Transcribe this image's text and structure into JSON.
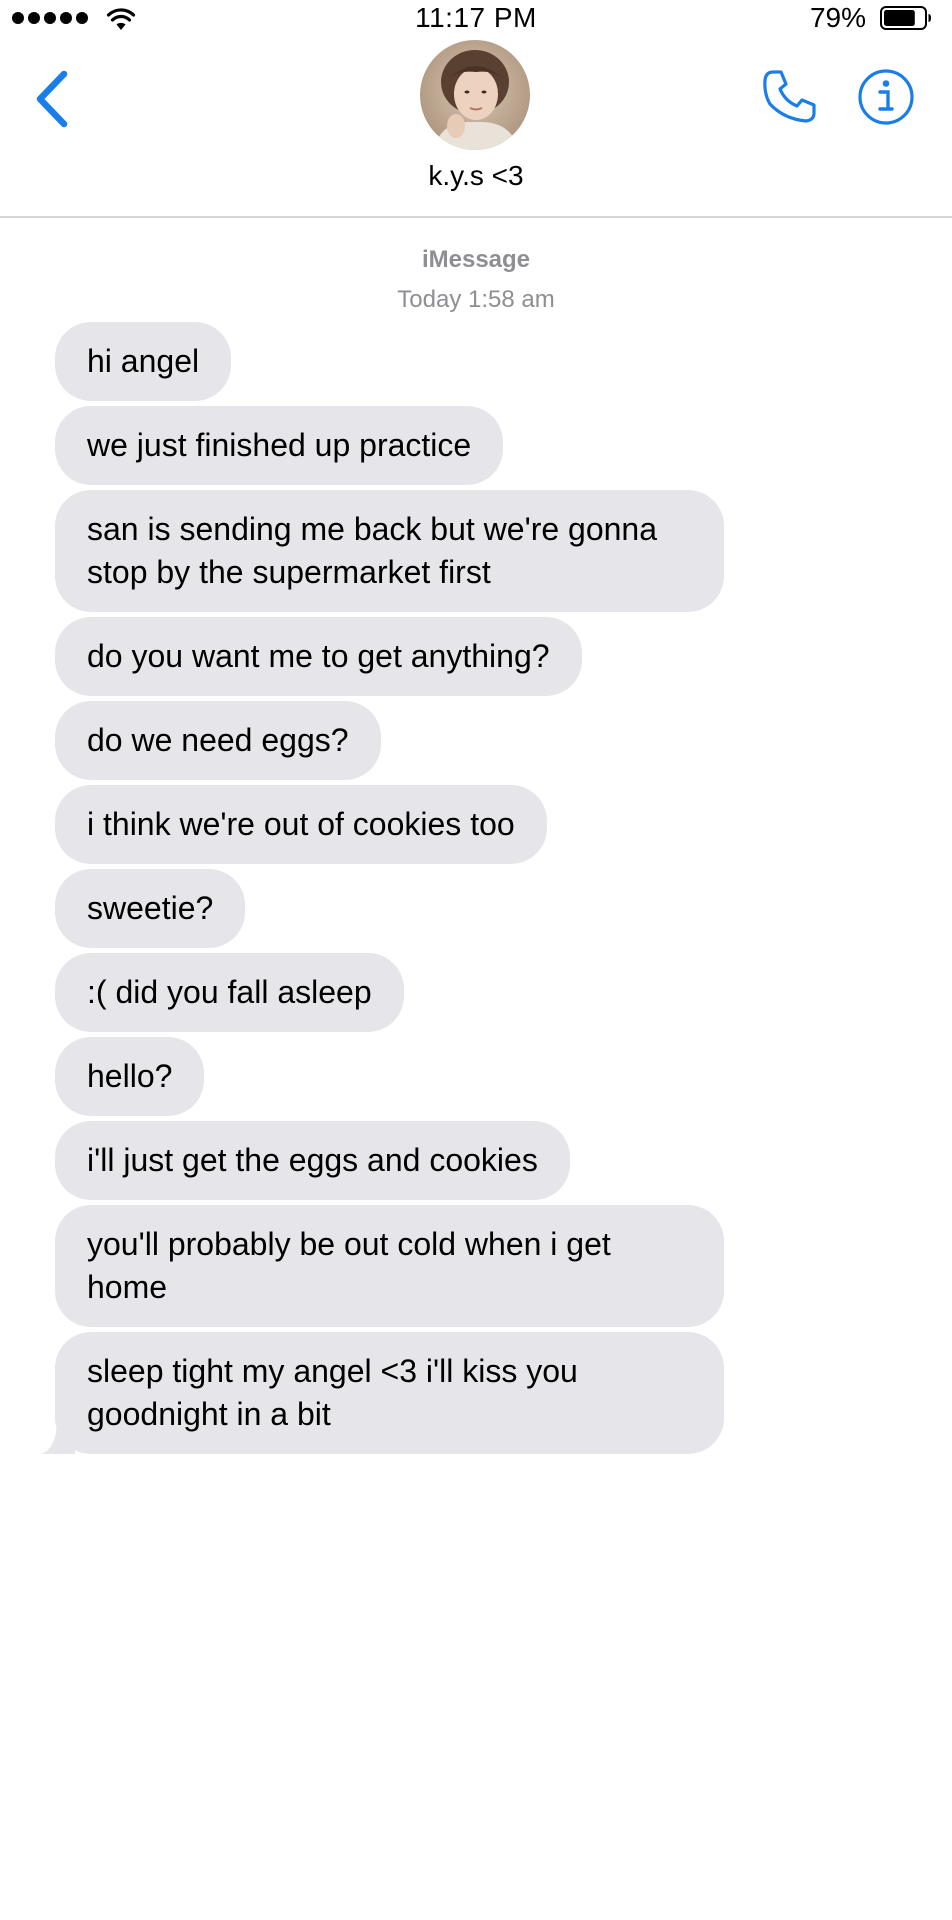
{
  "status_bar": {
    "time": "11:17 PM",
    "battery_percent": "79%",
    "battery_level": 0.79,
    "signal_bars": 5,
    "icons": [
      "signal-dots-icon",
      "wifi-icon",
      "battery-icon"
    ]
  },
  "header": {
    "contact_name": "k.y.s <3",
    "icons": [
      "back-chevron-icon",
      "phone-icon",
      "info-icon"
    ],
    "accent_color": "#1a7ee8"
  },
  "conversation": {
    "service": "iMessage",
    "timestamp": "Today 1:58 am",
    "bubble_color": "#e5e5ea",
    "messages": [
      {
        "text": "hi angel"
      },
      {
        "text": "we just finished up practice"
      },
      {
        "text": "san is sending me back but we're gonna stop by the supermarket first"
      },
      {
        "text": "do you want me to get anything?"
      },
      {
        "text": "do we need eggs?"
      },
      {
        "text": "i think we're out of cookies too"
      },
      {
        "text": "sweetie?"
      },
      {
        "text": ":( did you fall asleep"
      },
      {
        "text": "hello?"
      },
      {
        "text": "i'll just get the eggs and cookies"
      },
      {
        "text": "you'll probably be out cold when i get home"
      },
      {
        "text": "sleep tight my angel <3 i'll kiss you goodnight in a bit"
      }
    ]
  }
}
